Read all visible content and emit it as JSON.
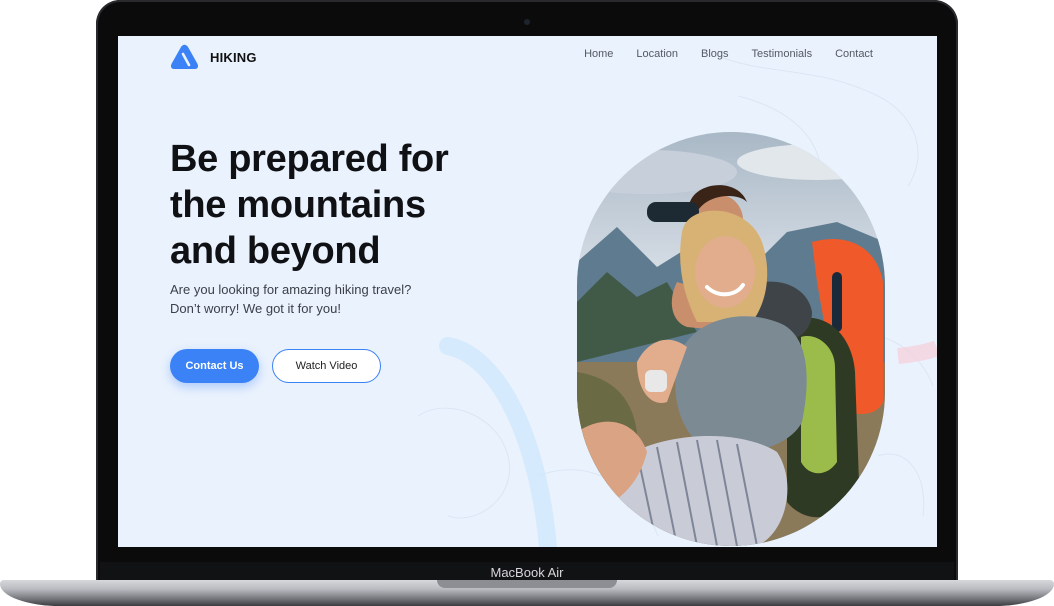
{
  "device": {
    "label": "MacBook Air"
  },
  "site": {
    "brand": "HIKING",
    "logo_icon": "mountain-icon",
    "accent_color": "#3b82f6"
  },
  "nav": {
    "items": [
      {
        "label": "Home"
      },
      {
        "label": "Location"
      },
      {
        "label": "Blogs"
      },
      {
        "label": "Testimonials"
      },
      {
        "label": "Contact"
      }
    ]
  },
  "hero": {
    "title": "Be prepared for the mountains and beyond",
    "subtitle": "Are you looking for amazing hiking travel? Don’t worry! We got it for you!",
    "primary_button": "Contact Us",
    "secondary_button": "Watch Video"
  }
}
